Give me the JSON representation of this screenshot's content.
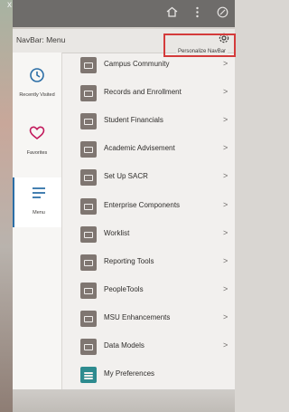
{
  "top_bar": {
    "icons": [
      "home-icon",
      "more-vertical-icon",
      "compass-icon"
    ],
    "corner_mark": "x"
  },
  "panel": {
    "title": "NavBar: Menu",
    "personalize_tooltip": "Personalize NavBar",
    "personalize_icon": "gear-icon"
  },
  "nav": {
    "tiles": [
      {
        "label": "Recently Visited",
        "icon": "clock-icon"
      },
      {
        "label": "Favorites",
        "icon": "heart-icon"
      },
      {
        "label": "Menu",
        "icon": "menu-icon",
        "active": true
      }
    ]
  },
  "menu": {
    "items": [
      {
        "label": "Campus Community",
        "icon": "folder-icon"
      },
      {
        "label": "Records and Enrollment",
        "icon": "folder-icon"
      },
      {
        "label": "Student Financials",
        "icon": "folder-icon"
      },
      {
        "label": "Academic Advisement",
        "icon": "folder-icon"
      },
      {
        "label": "Set Up SACR",
        "icon": "folder-icon"
      },
      {
        "label": "Enterprise Components",
        "icon": "folder-icon"
      },
      {
        "label": "Worklist",
        "icon": "folder-icon"
      },
      {
        "label": "Reporting Tools",
        "icon": "folder-icon"
      },
      {
        "label": "PeopleTools",
        "icon": "folder-icon"
      },
      {
        "label": "MSU Enhancements",
        "icon": "folder-icon"
      },
      {
        "label": "Data Models",
        "icon": "folder-icon"
      },
      {
        "label": "My Preferences",
        "icon": "preferences-icon"
      }
    ],
    "chevron": ">"
  },
  "colors": {
    "highlight": "#d43b3b",
    "active_accent": "#2b6ea6",
    "folder": "#7f7671",
    "preferences": "#2e8b8f"
  }
}
